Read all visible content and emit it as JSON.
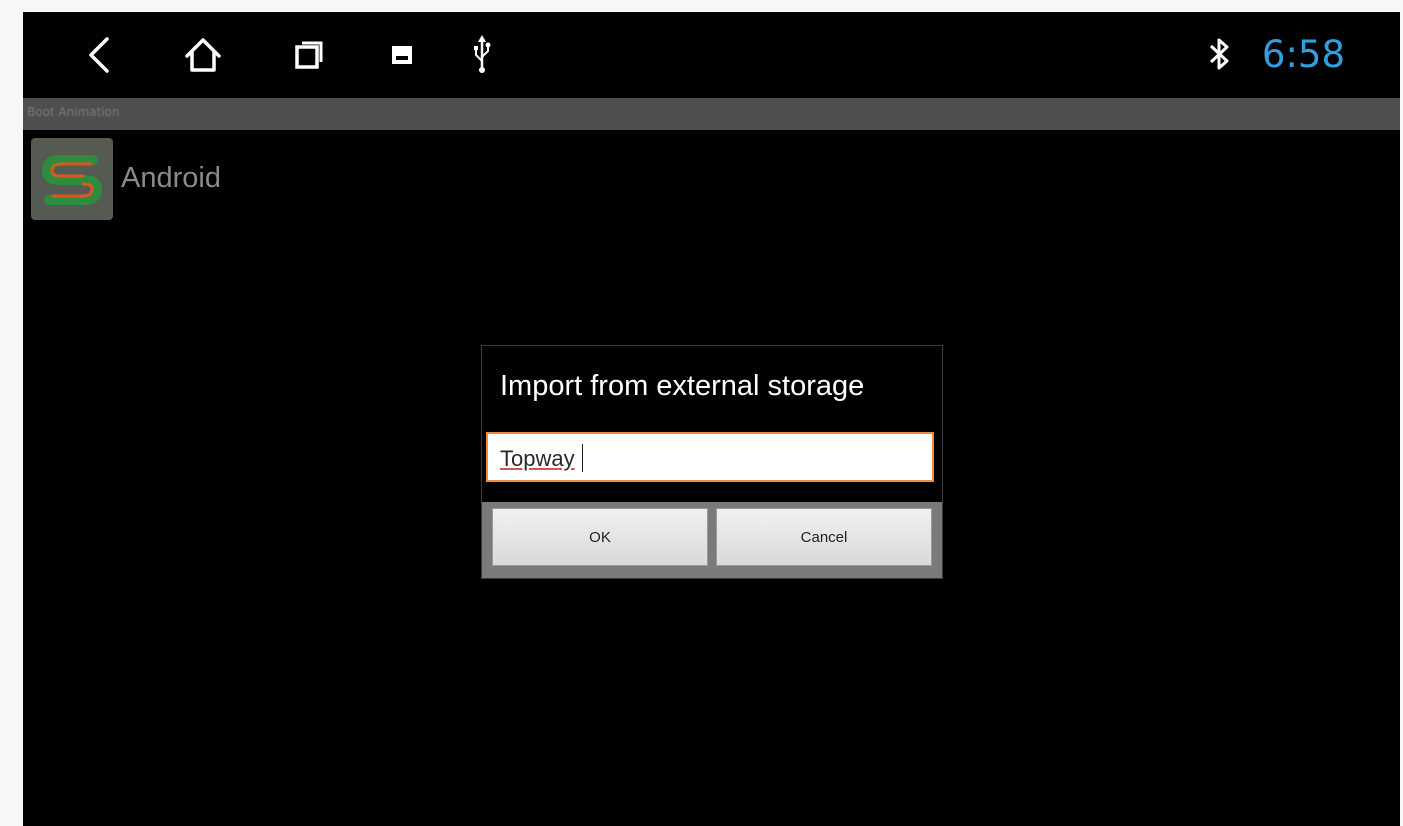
{
  "status_bar": {
    "icons": [
      "back-icon",
      "home-icon",
      "recent-apps-icon",
      "gallery-icon",
      "usb-icon",
      "bluetooth-icon"
    ],
    "time": "6:58",
    "time_color": "#2f9fe0"
  },
  "app_bar": {
    "title": "Boot Animation"
  },
  "app_item": {
    "icon": "s-logo-icon",
    "label": "Android"
  },
  "dialog": {
    "title": "Import from external storage",
    "input_value": "Topway",
    "accent_color": "#f08a3c",
    "ok_label": "OK",
    "cancel_label": "Cancel"
  }
}
